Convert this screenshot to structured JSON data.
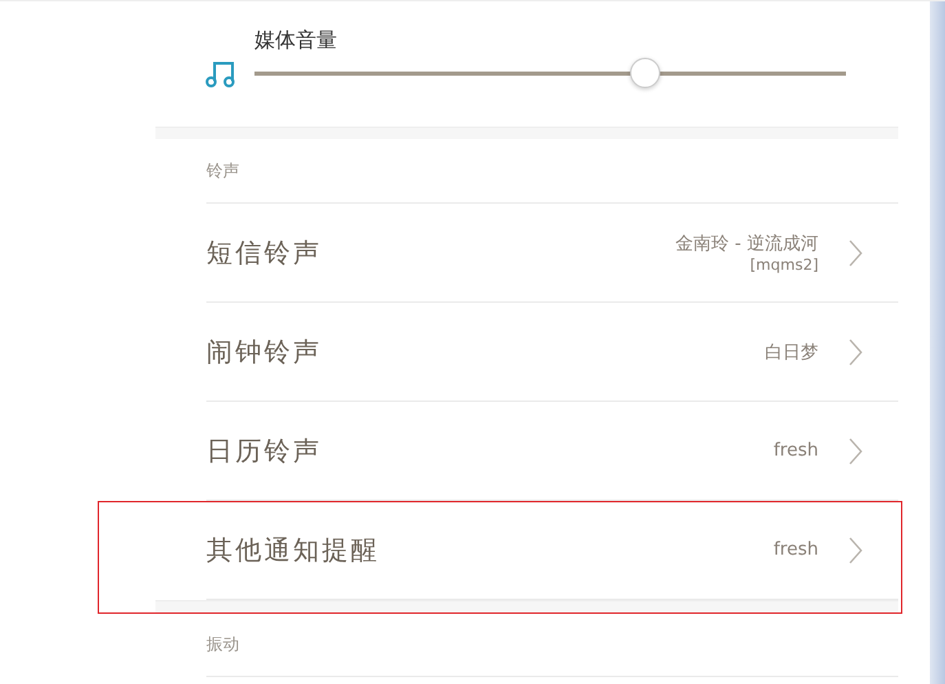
{
  "media_volume": {
    "label": "媒体音量",
    "level": 0.66
  },
  "sections": [
    {
      "header": "铃声",
      "rows": [
        {
          "label": "短信铃声",
          "value_lines": [
            "金南玲 - 逆流成河",
            "[mqms2]"
          ],
          "highlighted": false
        },
        {
          "label": "闹钟铃声",
          "value_lines": [
            "白日梦"
          ],
          "highlighted": false
        },
        {
          "label": "日历铃声",
          "value_lines": [
            "fresh"
          ],
          "highlighted": false
        },
        {
          "label": "其他通知提醒",
          "value_lines": [
            "fresh"
          ],
          "highlighted": true
        }
      ]
    },
    {
      "header": "振动"
    }
  ]
}
